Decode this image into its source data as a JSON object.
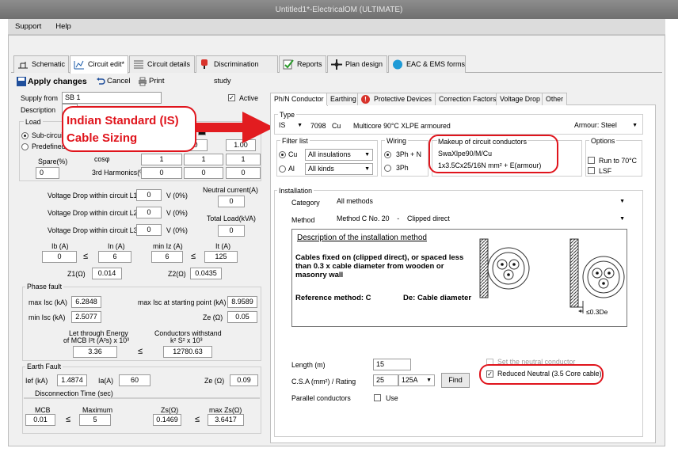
{
  "window": {
    "title": "Untitled1*-ElectricalOM (ULTIMATE)"
  },
  "menu": [
    "Support",
    "Help"
  ],
  "main_tabs": [
    "Schematic",
    "Circuit edit*",
    "Circuit details",
    "Discrimination study",
    "Reports",
    "Plan design",
    "EAC & EMS forms"
  ],
  "toolbar": {
    "apply": "Apply changes",
    "cancel": "Cancel",
    "print": "Print"
  },
  "left": {
    "supply_from_label": "Supply from",
    "supply_from": "SB 1",
    "description_label": "Description",
    "active_label": "Active",
    "load_label": "Load",
    "subcircuit": "Sub-circuit",
    "predefined": "Predefined",
    "spare_label": "Spare(%)",
    "spare": "0",
    "cosphi_label": "cosφ",
    "harm_label": "3rd Harmonics(%)",
    "row1": [
      "0",
      "0",
      "1.00"
    ],
    "cos": [
      "1",
      "1",
      "1"
    ],
    "harm": [
      "0",
      "0",
      "0"
    ],
    "vd1_label": "Voltage Drop within circuit L1",
    "vd2_label": "Voltage Drop within circuit L2",
    "vd3_label": "Voltage Drop within circuit L3",
    "vd1": "0",
    "vd2": "0",
    "vd3": "0",
    "vd_unit": "V (0%)",
    "neutral_label": "Neutral current(A)",
    "neutral": "0",
    "total_label": "Total Load(kVA)",
    "total": "0",
    "ib_label": "Ib (A)",
    "in_label": "In (A)",
    "iz_label": "min Iz (A)",
    "it_label": "It (A)",
    "ib": "0",
    "in": "6",
    "iz": "6",
    "it": "125",
    "le": "≤",
    "z1_label": "Z1(Ω)",
    "z1": "0.014",
    "z2_label": "Z2(Ω)",
    "z2": "0.0435",
    "phase_fault": "Phase fault",
    "maxisc_label": "max Isc (kA)",
    "maxisc": "6.2848",
    "maxisc_sp_label": "max Isc at starting point (kA)",
    "maxisc_sp": "8.9589",
    "minisc_label": "min Isc (kA)",
    "minisc": "2.5077",
    "ze_label": "Ze (Ω)",
    "ze": "0.05",
    "let_label1": "Let through Energy",
    "let_label2": "of MCB I²t (A²s) x 10³",
    "let": "3.36",
    "cw_label1": "Conductors withstand",
    "cw_label2": "k² S² x 10³",
    "cw": "12780.63",
    "earth_fault": "Earth Fault",
    "ief_label": "Ief (kA)",
    "ief": "1.4874",
    "ia_label": "Ia(A)",
    "ia": "60",
    "ze2_label": "Ze (Ω)",
    "ze2": "0.09",
    "disc_label": "Disconnection Time (sec)",
    "mcb_label": "MCB",
    "mcb": "0.01",
    "max_label": "Maximum",
    "max": "5",
    "zs_label": "Zs(Ω)",
    "zs": "0.1469",
    "maxzs_label": "max Zs(Ω)",
    "maxzs": "3.6417"
  },
  "annotation": {
    "line1": "Indian Standard (IS)",
    "line2": "Cable Sizing"
  },
  "right": {
    "tabs": [
      "Ph/N Conductor",
      "Earthing",
      "Protective Devices",
      "Correction Factors",
      "Voltage Drop",
      "Other"
    ],
    "type_label": "Type",
    "std": "IS",
    "code": "7098",
    "metal": "Cu",
    "desc": "Multicore 90°C XLPE armoured",
    "armour": "Armour: Steel",
    "filter_label": "Filter list",
    "cu": "Cu",
    "al": "Al",
    "ins": "All insulations",
    "kinds": "All kinds",
    "wiring_label": "Wiring",
    "w1": "3Ph + N",
    "w2": "3Ph",
    "makeup_label": "Makeup of circuit conductors",
    "makeup1": "SwaXlpe90/M/Cu",
    "makeup2": "1x3.5Cx25/16N mm² + E(armour)",
    "options_label": "Options",
    "opt1": "Run to 70°C",
    "opt2": "LSF",
    "inst_label": "Installation",
    "cat_label": "Category",
    "cat": "All methods",
    "method_label": "Method",
    "method": "Method C No. 20    -    Clipped direct",
    "desc_title": "Description of the installation method",
    "desc_text": "Cables fixed on (clipped direct), or spaced less than 0.3 x cable diameter from wooden or masonry wall",
    "ref": "Reference method: C",
    "de": "De: Cable diameter",
    "dim": "≤0.3De",
    "length_label": "Length (m)",
    "length": "15",
    "csa_label": "C.S.A (mm²) / Rating",
    "csa": "25",
    "rating": "125A",
    "find": "Find",
    "parallel_label": "Parallel conductors",
    "use": "Use",
    "set_neutral": "Set the neutral conductor",
    "reduced": "Reduced Neutral (3.5 Core cable)"
  },
  "colors": {
    "accent_red": "#e0141c",
    "tab_border": "#b6b6b6"
  }
}
